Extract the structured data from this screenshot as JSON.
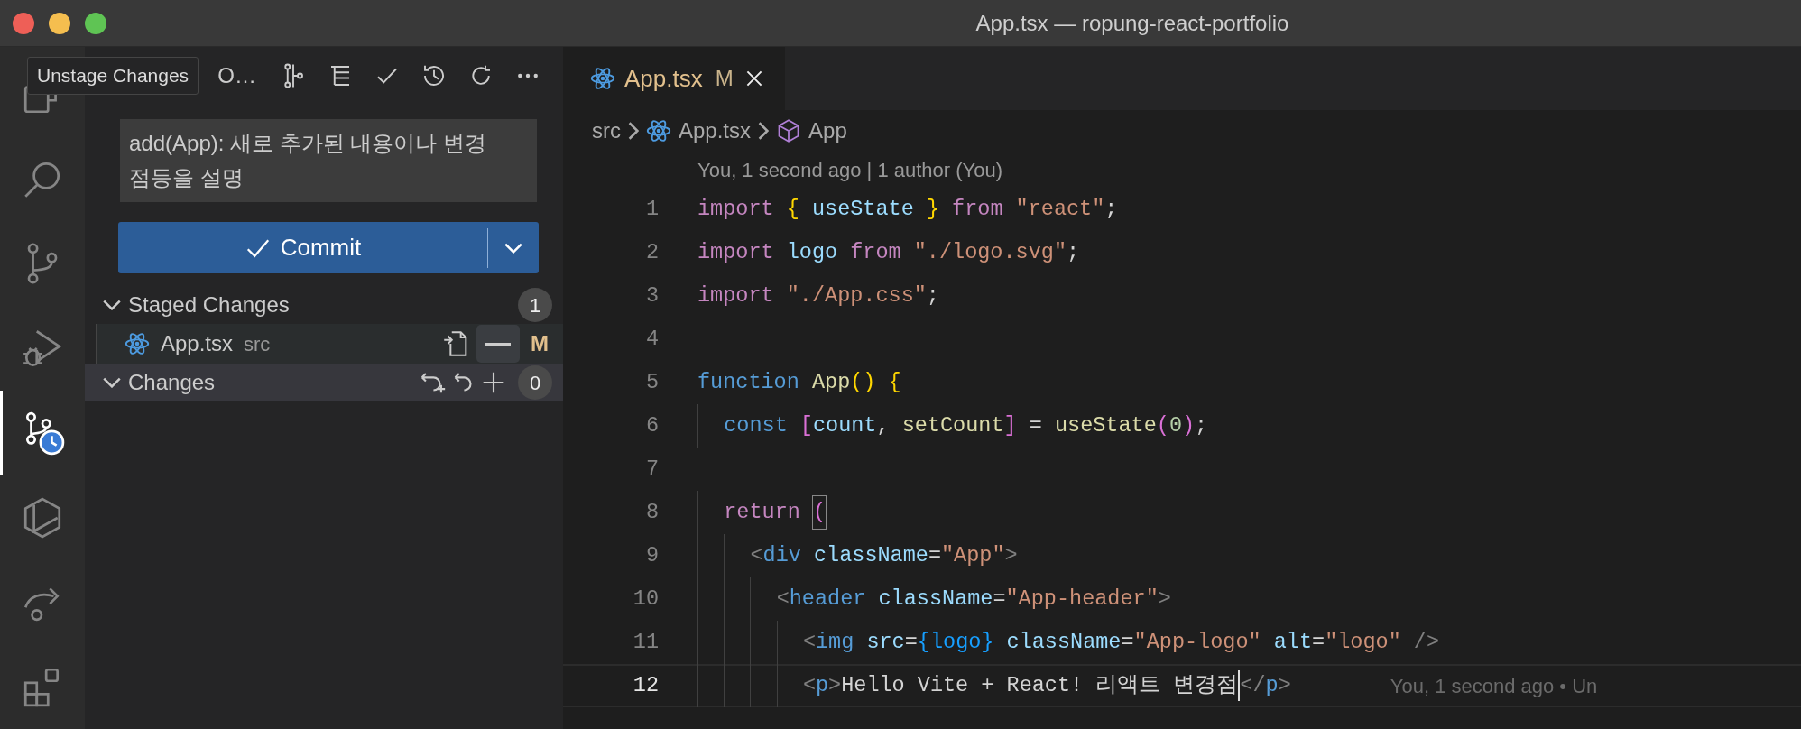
{
  "window": {
    "title": "App.tsx — ropung-react-portfolio"
  },
  "activity_bar": [
    {
      "kind": "files",
      "selected": false
    },
    {
      "kind": "search",
      "selected": false
    },
    {
      "kind": "branch",
      "selected": false
    },
    {
      "kind": "debug",
      "selected": false
    },
    {
      "kind": "history",
      "selected": true
    },
    {
      "kind": "hexplay",
      "selected": false
    },
    {
      "kind": "forward",
      "selected": false
    },
    {
      "kind": "extensions",
      "selected": false
    }
  ],
  "tooltip": {
    "text": "Unstage Changes"
  },
  "source_control": {
    "title": "O…",
    "commit_message": "add(App): 새로 추가된 내용이나 변경 점등을 설명",
    "commit_button": "Commit",
    "groups": [
      {
        "label": "Staged Changes",
        "expanded": true,
        "selected": false,
        "count": "1",
        "files": [
          {
            "name": "App.tsx",
            "folder": "src",
            "status": "M",
            "hovered": true
          }
        ]
      },
      {
        "label": "Changes",
        "expanded": true,
        "selected": true,
        "count": "0"
      }
    ]
  },
  "editor": {
    "tabs": [
      {
        "label": "App.tsx",
        "status": "M",
        "selected": true
      }
    ],
    "breadcrumb": [
      {
        "kind": "folder",
        "text": "src"
      },
      {
        "kind": "file",
        "text": "App.tsx"
      },
      {
        "kind": "symbol",
        "text": "App"
      }
    ],
    "codelens": "You, 1 second ago | 1 author (You)",
    "lines": [
      {
        "number": "1",
        "current": false,
        "tokens": [
          {
            "kind": "kw",
            "text": "import "
          },
          {
            "kind": "b1",
            "text": "{ "
          },
          {
            "kind": "var",
            "text": "useState "
          },
          {
            "kind": "b1",
            "text": "} "
          },
          {
            "kind": "kw",
            "text": "from "
          },
          {
            "kind": "str",
            "text": "\"react\""
          },
          {
            "kind": "p",
            "text": ";"
          }
        ]
      },
      {
        "number": "2",
        "current": false,
        "tokens": [
          {
            "kind": "kw",
            "text": "import "
          },
          {
            "kind": "var",
            "text": "logo "
          },
          {
            "kind": "kw",
            "text": "from "
          },
          {
            "kind": "str",
            "text": "\"./logo.svg\""
          },
          {
            "kind": "p",
            "text": ";"
          }
        ]
      },
      {
        "number": "3",
        "current": false,
        "tokens": [
          {
            "kind": "kw",
            "text": "import "
          },
          {
            "kind": "str",
            "text": "\"./App.css\""
          },
          {
            "kind": "p",
            "text": ";"
          }
        ]
      },
      {
        "number": "4",
        "current": false
      },
      {
        "number": "5",
        "current": false,
        "tokens": [
          {
            "kind": "decl",
            "text": "function "
          },
          {
            "kind": "fn",
            "text": "App"
          },
          {
            "kind": "b1",
            "text": "() {"
          }
        ]
      },
      {
        "number": "6",
        "current": false,
        "tokens": [
          {
            "kind": "decl",
            "text": "  const "
          },
          {
            "kind": "b2",
            "text": "["
          },
          {
            "kind": "var",
            "text": "count"
          },
          {
            "kind": "p",
            "text": ", "
          },
          {
            "kind": "fn",
            "text": "setCount"
          },
          {
            "kind": "b2",
            "text": "]"
          },
          {
            "kind": "p",
            "text": " = "
          },
          {
            "kind": "fn",
            "text": "useState"
          },
          {
            "kind": "b2",
            "text": "("
          },
          {
            "kind": "num",
            "text": "0"
          },
          {
            "kind": "b2",
            "text": ")"
          },
          {
            "kind": "p",
            "text": ";"
          }
        ]
      },
      {
        "number": "7",
        "current": false
      },
      {
        "number": "8",
        "current": false,
        "tokens": [
          {
            "kind": "kw",
            "text": "  return "
          },
          {
            "kind": "b2match",
            "text": "("
          }
        ]
      },
      {
        "number": "9",
        "current": false,
        "tokens": [
          {
            "kind": "tagp",
            "text": "    <"
          },
          {
            "kind": "tag",
            "text": "div "
          },
          {
            "kind": "attr",
            "text": "className"
          },
          {
            "kind": "p",
            "text": "="
          },
          {
            "kind": "str",
            "text": "\"App\""
          },
          {
            "kind": "tagp",
            "text": ">"
          }
        ]
      },
      {
        "number": "10",
        "current": false,
        "tokens": [
          {
            "kind": "tagp",
            "text": "      <"
          },
          {
            "kind": "tag",
            "text": "header "
          },
          {
            "kind": "attr",
            "text": "className"
          },
          {
            "kind": "p",
            "text": "="
          },
          {
            "kind": "str",
            "text": "\"App-header\""
          },
          {
            "kind": "tagp",
            "text": ">"
          }
        ]
      },
      {
        "number": "11",
        "current": false,
        "tokens": [
          {
            "kind": "tagp",
            "text": "        <"
          },
          {
            "kind": "tag",
            "text": "img "
          },
          {
            "kind": "attr",
            "text": "src"
          },
          {
            "kind": "p",
            "text": "="
          },
          {
            "kind": "b3",
            "text": "{logo} "
          },
          {
            "kind": "attr",
            "text": "className"
          },
          {
            "kind": "p",
            "text": "="
          },
          {
            "kind": "str",
            "text": "\"App-logo\" "
          },
          {
            "kind": "attr",
            "text": "alt"
          },
          {
            "kind": "p",
            "text": "="
          },
          {
            "kind": "str",
            "text": "\"logo\" "
          },
          {
            "kind": "tagp",
            "text": "/>"
          }
        ]
      },
      {
        "number": "12",
        "current": true,
        "caret": true,
        "blame": "You, 1 second ago • Un",
        "tokens": [
          {
            "kind": "tagp",
            "text": "        <"
          },
          {
            "kind": "tag",
            "text": "p"
          },
          {
            "kind": "tagp",
            "text": ">"
          },
          {
            "kind": "text",
            "text": "Hello Vite + React! 리액트 변경점"
          },
          {
            "kind": "tagp",
            "text": "</"
          },
          {
            "kind": "tag",
            "text": "p"
          },
          {
            "kind": "tagp",
            "text": ">"
          }
        ]
      }
    ]
  }
}
